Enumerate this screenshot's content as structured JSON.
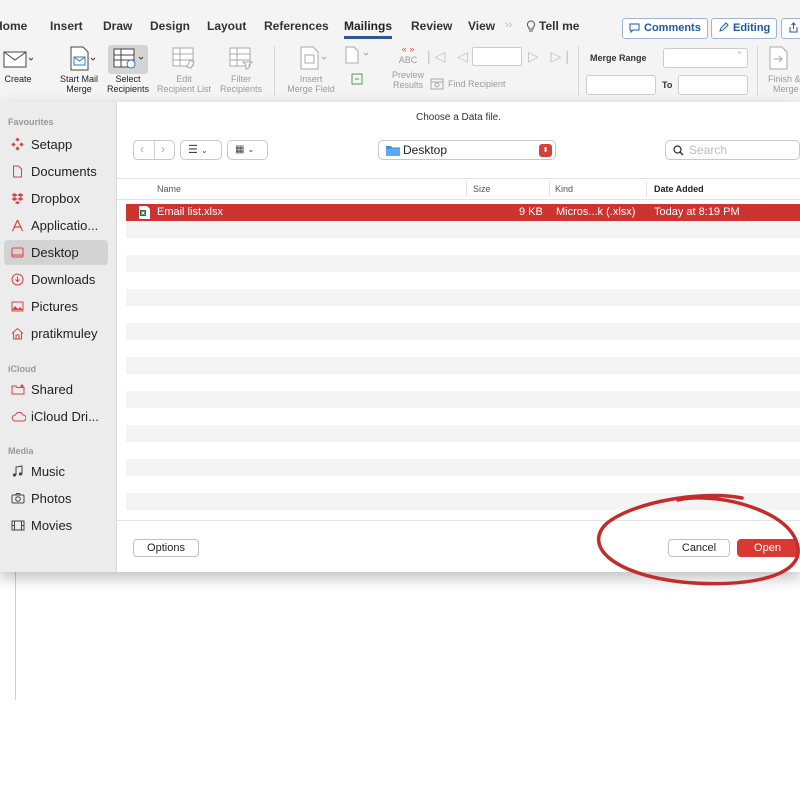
{
  "ribbon": {
    "tabs": [
      "Home",
      "Insert",
      "Draw",
      "Design",
      "Layout",
      "References",
      "Mailings",
      "Review",
      "View"
    ],
    "active_tab": "Mailings",
    "tell_me": "Tell me",
    "comments_label": "Comments",
    "editing_label": "Editing",
    "commands": {
      "create": "Create",
      "start_mail_merge_1": "Start Mail",
      "start_mail_merge_2": "Merge",
      "select_recipients_1": "Select",
      "select_recipients_2": "Recipients",
      "edit_recipient_list_1": "Edit",
      "edit_recipient_list_2": "Recipient List",
      "filter_recipients_1": "Filter",
      "filter_recipients_2": "Recipients",
      "insert_merge_field_1": "Insert",
      "insert_merge_field_2": "Merge Field",
      "preview_results_1": "Preview",
      "preview_results_2": "Results",
      "preview_abc": "ABC",
      "find_recipient": "Find Recipient",
      "merge_range": "Merge Range",
      "to": "To",
      "finish_merge_1": "Finish &",
      "finish_merge_2": "Merge"
    }
  },
  "dialog": {
    "title": "Choose a Data file.",
    "location": "Desktop",
    "search_placeholder": "Search",
    "sidebar": {
      "favourites_heading": "Favourites",
      "favourites": [
        "Setapp",
        "Documents",
        "Dropbox",
        "Applicatio...",
        "Desktop",
        "Downloads",
        "Pictures",
        "pratikmuley"
      ],
      "active": "Desktop",
      "icloud_heading": "iCloud",
      "icloud": [
        "Shared",
        "iCloud Dri..."
      ],
      "media_heading": "Media",
      "media": [
        "Music",
        "Photos",
        "Movies"
      ]
    },
    "columns": [
      "Name",
      "Size",
      "Kind",
      "Date Added"
    ],
    "files": [
      {
        "name": "Email list.xlsx",
        "size": "9 KB",
        "kind": "Micros...k (.xlsx)",
        "date_added": "Today at 8:19 PM",
        "selected": true
      }
    ],
    "options_label": "Options",
    "cancel_label": "Cancel",
    "open_label": "Open"
  },
  "colors": {
    "accent_red": "#d83a33",
    "selection_red": "#cc3430",
    "annotation_red": "#c32c2c",
    "ribbon_blue": "#2b5797"
  }
}
